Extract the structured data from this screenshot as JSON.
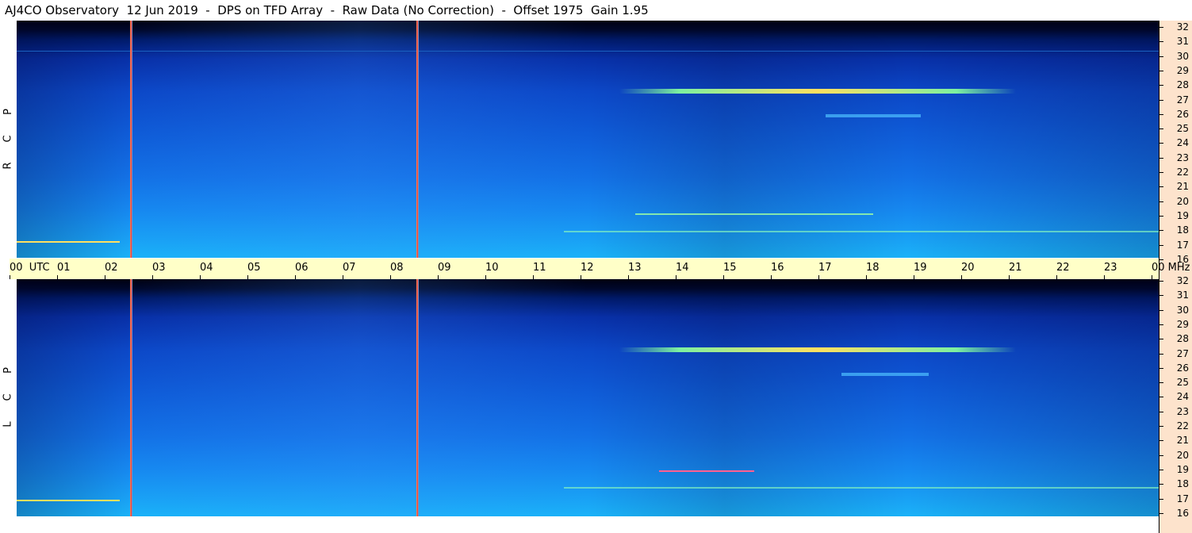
{
  "header": {
    "title": "AJ4CO Observatory  12 Jun 2019  -  DPS on TFD Array  -  Raw Data (No Correction)  -  Offset 1975  Gain 1.95"
  },
  "panels": {
    "rcp": {
      "label_letters": [
        "P",
        "C",
        "R"
      ]
    },
    "lcp": {
      "label_letters": [
        "P",
        "C",
        "L"
      ]
    }
  },
  "frequency_axis": {
    "ticks": [
      "32",
      "31",
      "30",
      "29",
      "28",
      "27",
      "26",
      "25",
      "24",
      "23",
      "22",
      "21",
      "20",
      "19",
      "18",
      "17",
      "16"
    ]
  },
  "time_axis": {
    "ticks": [
      "00  UTC",
      "01",
      "02",
      "03",
      "04",
      "05",
      "06",
      "07",
      "08",
      "09",
      "10",
      "11",
      "12",
      "13",
      "14",
      "15",
      "16",
      "17",
      "18",
      "19",
      "20",
      "21",
      "22",
      "23",
      "00 MHz"
    ]
  },
  "colors": {
    "axis_right_bg": "#fde3cc",
    "time_axis_bg": "#ffffc8",
    "spectro_low": "#000010",
    "spectro_high": "#1ab2f8",
    "emission_band": "#ffd040"
  }
}
